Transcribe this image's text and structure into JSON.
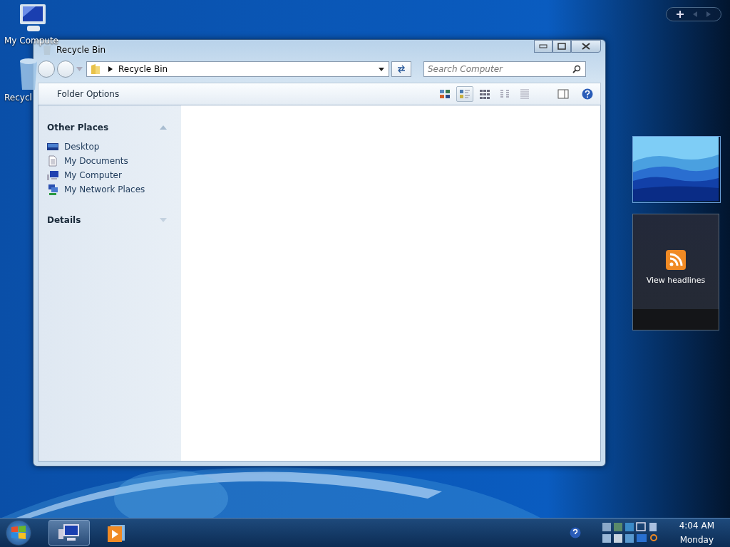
{
  "desktop_icons": [
    {
      "label": "My Compute",
      "kind": "computer"
    },
    {
      "label": "Recycl",
      "kind": "recycle"
    }
  ],
  "window": {
    "title": "Recycle Bin",
    "address": "Recycle Bin",
    "search": {
      "placeholder": "Search Computer"
    },
    "toolbar": {
      "button": "Folder Options",
      "views": [
        {
          "kind": "tiles",
          "selected": false
        },
        {
          "kind": "details",
          "selected": true
        },
        {
          "kind": "icons",
          "selected": false
        },
        {
          "kind": "list",
          "selected": false
        },
        {
          "kind": "lines",
          "selected": false
        }
      ]
    },
    "sidebar": {
      "sections": [
        {
          "title": "Other Places",
          "expanded": true,
          "items": [
            {
              "label": "Desktop",
              "kind": "desktop"
            },
            {
              "label": "My Documents",
              "kind": "document"
            },
            {
              "label": "My Computer",
              "kind": "computer"
            },
            {
              "label": "My Network Places",
              "kind": "network"
            }
          ]
        },
        {
          "title": "Details",
          "expanded": false
        }
      ]
    }
  },
  "gadgets": {
    "feed": {
      "label": "View headlines"
    }
  },
  "taskbar": {
    "buttons": [
      {
        "kind": "computer",
        "selected": true
      },
      {
        "kind": "media",
        "selected": false
      }
    ],
    "clock": {
      "time": "4:04 AM",
      "day": "Monday"
    }
  }
}
